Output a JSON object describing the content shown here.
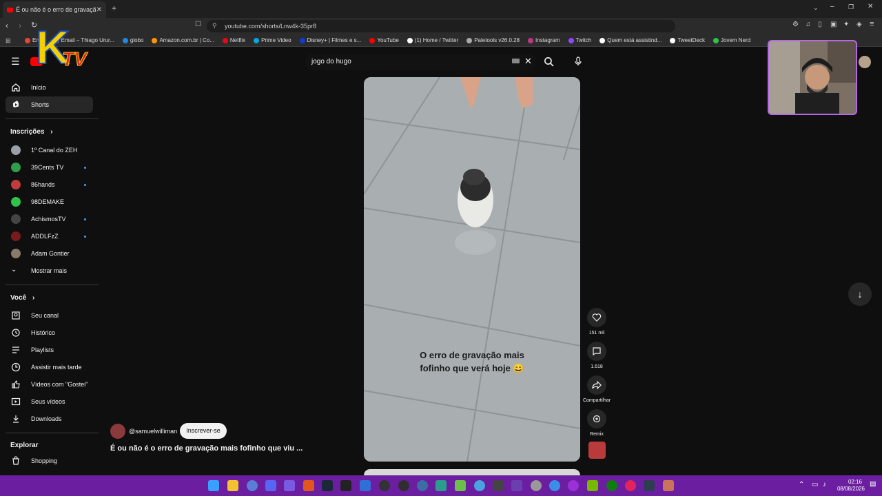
{
  "browser": {
    "tab_title": "É ou não é o erro de gravação mais fofinho que viu",
    "url": "youtube.com/shorts/Lnw4k-35pr8",
    "bookmarks": [
      "Em...",
      "Email – Thiago Urur...",
      "globo",
      "Amazon.com.br | Co...",
      "Netflix",
      "Prime Video",
      "Disney+ | Filmes e s...",
      "YouTube",
      "(1) Home / Twitter",
      "Paletools v26.0.28",
      "Instagram",
      "Twitch",
      "Quem está assistind...",
      "TweetDeck",
      "Jovem Nerd"
    ]
  },
  "overlay": {
    "logo_k": "K",
    "logo_tv": "TV"
  },
  "sidebar": {
    "main": [
      {
        "label": "Início",
        "icon": "home-icon"
      },
      {
        "label": "Shorts",
        "icon": "shorts-icon"
      }
    ],
    "subscriptions_heading": "Inscrições",
    "subscriptions": [
      {
        "label": "1º Canal do ZEH",
        "color": "#9aa0a6",
        "new": false
      },
      {
        "label": "39Cents TV",
        "color": "#2e9e4a",
        "new": true
      },
      {
        "label": "86hands",
        "color": "#c23b3b",
        "new": true
      },
      {
        "label": "98DEMAKE",
        "color": "#2ec44a",
        "new": false
      },
      {
        "label": "AchismosTV",
        "color": "#444444",
        "new": true
      },
      {
        "label": "ADDLFzZ",
        "color": "#7a1a1a",
        "new": true
      },
      {
        "label": "Adam Gontier",
        "color": "#8a7a6a",
        "new": false
      }
    ],
    "show_more": "Mostrar mais",
    "you_heading": "Você",
    "you_items": [
      {
        "label": "Seu canal",
        "icon": "channel-icon"
      },
      {
        "label": "Histórico",
        "icon": "history-icon"
      },
      {
        "label": "Playlists",
        "icon": "playlists-icon"
      },
      {
        "label": "Assistir mais tarde",
        "icon": "watch-later-icon"
      },
      {
        "label": "Vídeos com \"Gostei\"",
        "icon": "like-icon"
      },
      {
        "label": "Seus vídeos",
        "icon": "your-videos-icon"
      },
      {
        "label": "Downloads",
        "icon": "download-icon"
      }
    ],
    "explore_heading": "Explorar",
    "explore_items": [
      {
        "label": "Shopping",
        "icon": "shopping-icon"
      }
    ]
  },
  "search": {
    "value": "jogo do hugo"
  },
  "short": {
    "caption_line1": "O erro de gravação mais",
    "caption_line2": "fofinho que verá hoje 😄",
    "likes": "151 mil",
    "comments": "1.618",
    "share_label": "Compartilhar",
    "remix_label": "Remix",
    "channel": "@samuelwilliman",
    "subscribe_label": "Inscrever-se",
    "title": "É ou não é o erro de gravação mais fofinho que viu ..."
  },
  "taskbar": {
    "time": "02:16",
    "date": "08/08/2026"
  }
}
